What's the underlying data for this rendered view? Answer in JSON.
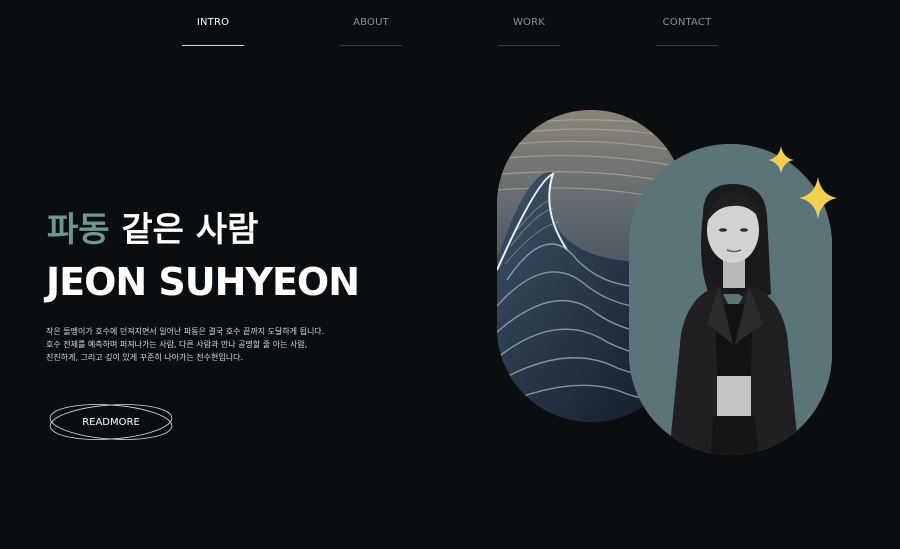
{
  "nav": {
    "items": [
      {
        "label": "INTRO",
        "active": true
      },
      {
        "label": "ABOUT",
        "active": false
      },
      {
        "label": "WORK",
        "active": false
      },
      {
        "label": "CONTACT",
        "active": false
      }
    ]
  },
  "hero": {
    "title_kor_accent": "파동",
    "title_kor_rest": " 같은 사람",
    "title_eng": "JEON SUHYEON",
    "description": [
      "작은 돌멩이가 호수에 던져지면서 일어난 파동은 결국 호수 끝까지 도달하게 됩니다.",
      "호수 전체를 예측하며 퍼져나가는 사람, 다른 사람과 만나 공명할 줄 아는 사람,",
      "진진하게, 그리고 깊이 있게 꾸준히 나아가는 전수현입니다."
    ],
    "readmore_label": "READMORE"
  },
  "images": {
    "wave": "wave-photo",
    "portrait": "portrait-photo"
  },
  "colors": {
    "background": "#0b0e11",
    "accent_teal": "#6d9891",
    "portrait_bg": "#5a7479",
    "sparkle": "#f4cf4d"
  }
}
